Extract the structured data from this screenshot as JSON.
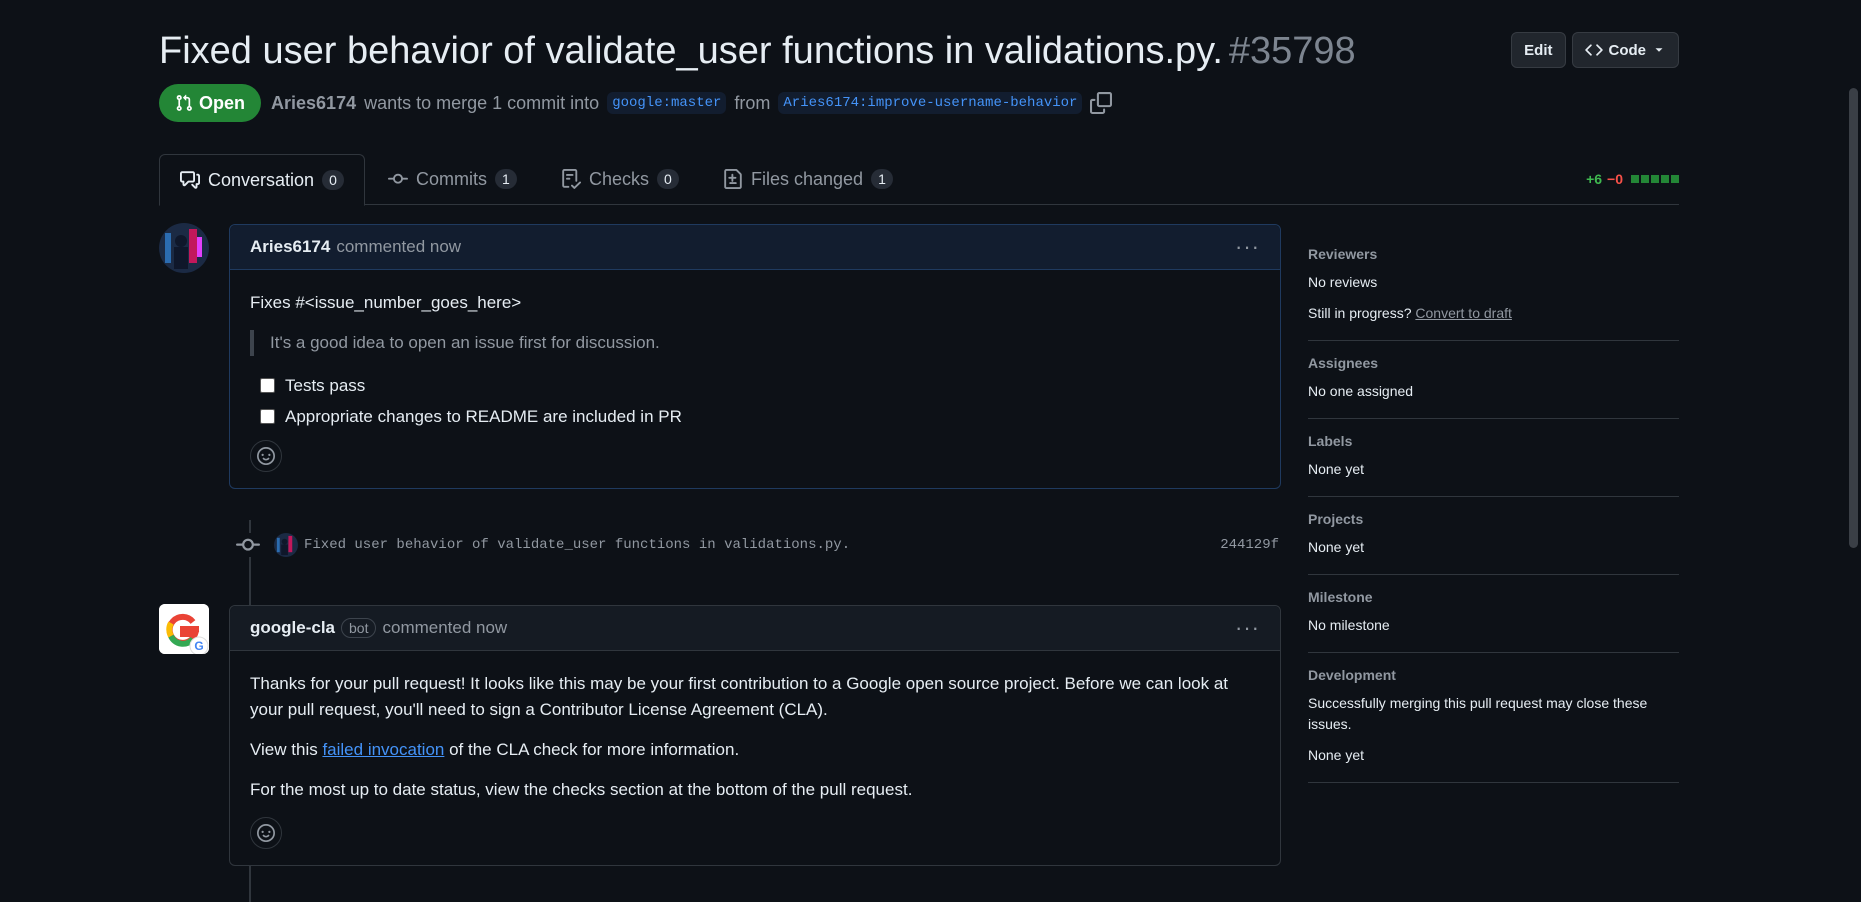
{
  "pr": {
    "title": "Fixed user behavior of validate_user functions in validations.py.",
    "number": "#35798",
    "status": "Open",
    "author": "Aries6174",
    "merge_text": "wants to merge 1 commit into",
    "base_branch": "google:master",
    "from_text": "from",
    "head_branch": "Aries6174:improve-username-behavior"
  },
  "header_buttons": {
    "edit": "Edit",
    "code": "Code"
  },
  "tabs": [
    {
      "label": "Conversation",
      "count": "0",
      "icon": "comment-discussion-icon"
    },
    {
      "label": "Commits",
      "count": "1",
      "icon": "git-commit-icon"
    },
    {
      "label": "Checks",
      "count": "0",
      "icon": "checklist-icon"
    },
    {
      "label": "Files changed",
      "count": "1",
      "icon": "file-diff-icon"
    }
  ],
  "diffstat": {
    "additions": "+6",
    "deletions": "−0"
  },
  "comments": [
    {
      "author": "Aries6174",
      "time": "commented now",
      "line1": "Fixes #<issue_number_goes_here>",
      "quote": "It's a good idea to open an issue first for discussion.",
      "tasks": [
        "Tests pass",
        "Appropriate changes to README are included in PR"
      ]
    },
    {
      "author": "google-cla",
      "badge": "bot",
      "time": "commented now",
      "p1": "Thanks for your pull request! It looks like this may be your first contribution to a Google open source project. Before we can look at your pull request, you'll need to sign a Contributor License Agreement (CLA).",
      "p2_before": "View this ",
      "p2_link": "failed invocation",
      "p2_after": " of the CLA check for more information.",
      "p3": "For the most up to date status, view the checks section at the bottom of the pull request."
    }
  ],
  "commit": {
    "message": "Fixed user behavior of validate_user functions in validations.py.",
    "sha": "244129f"
  },
  "sidebar": {
    "reviewers": {
      "title": "Reviewers",
      "value": "No reviews",
      "progress": "Still in progress?",
      "draft_link": "Convert to draft"
    },
    "assignees": {
      "title": "Assignees",
      "value": "No one assigned"
    },
    "labels": {
      "title": "Labels",
      "value": "None yet"
    },
    "projects": {
      "title": "Projects",
      "value": "None yet"
    },
    "milestone": {
      "title": "Milestone",
      "value": "No milestone"
    },
    "development": {
      "title": "Development",
      "desc": "Successfully merging this pull request may close these issues.",
      "value": "None yet"
    }
  },
  "colors": {
    "open_green": "#238636",
    "link_blue": "#4493f8",
    "bg": "#0d1117"
  }
}
